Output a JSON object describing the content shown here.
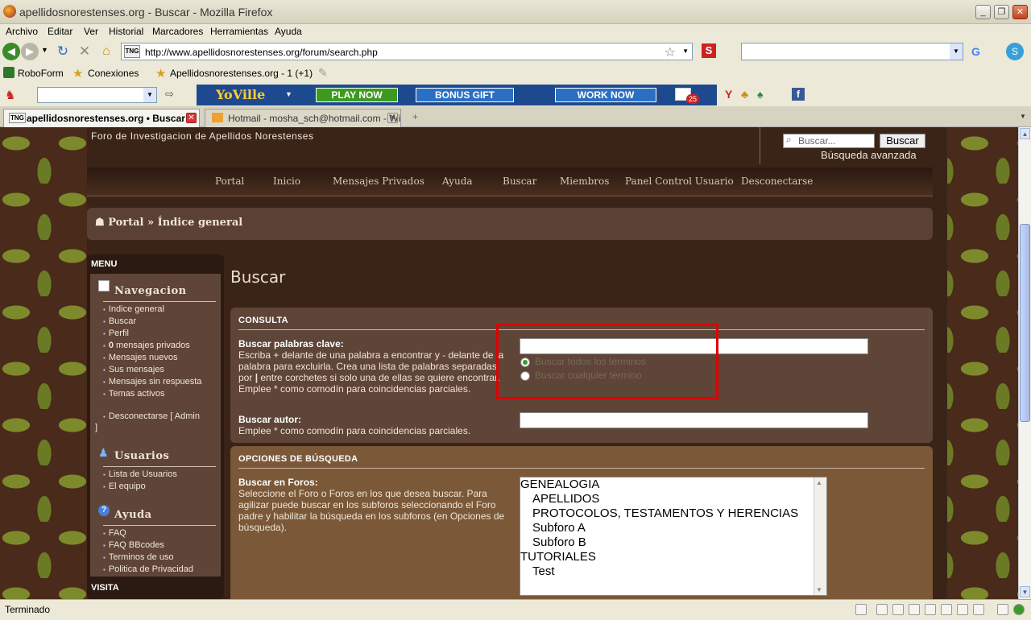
{
  "window": {
    "title": "apellidosnorestenses.org - Buscar - Mozilla Firefox"
  },
  "menubar": {
    "items": [
      "Archivo",
      "Editar",
      "Ver",
      "Historial",
      "Marcadores",
      "Herramientas",
      "Ayuda"
    ]
  },
  "navbar": {
    "url": "http://www.apellidosnorestenses.org/forum/search.php"
  },
  "bookmarks": {
    "items": [
      "RoboForm",
      "Conexiones",
      "Apellidosnorestenses.org - 1 (+1)"
    ]
  },
  "gamebar": {
    "brand": "YoVille",
    "play_now": "PLAY NOW",
    "bonus_gift": "BONUS GIFT",
    "work_now": "WORK NOW",
    "mail_count": "25"
  },
  "tabs": [
    {
      "label": "apellidosnorestenses.org • Buscar"
    },
    {
      "label": "Hotmail - mosha_sch@hotmail.com - Wi..."
    }
  ],
  "site": {
    "subtitle": "Foro de Investigacion de Apellidos Norestenses",
    "search_placeholder": "Buscar...",
    "search_button": "Buscar",
    "advanced_search": "Búsqueda avanzada",
    "nav": [
      "Portal",
      "Inicio",
      "Mensajes Privados",
      "Ayuda",
      "Buscar",
      "Miembros",
      "Panel Control Usuario",
      "Desconectarse"
    ],
    "breadcrumb": "Portal » Índice general"
  },
  "sidebar": {
    "menu_label": "MENU",
    "nav_title": "Navegacion",
    "nav_items": [
      "Indice general",
      "Buscar",
      "Perfil",
      "mensajes privados",
      "Mensajes nuevos",
      "Sus mensajes",
      "Mensajes sin respuesta",
      "Temas activos"
    ],
    "private_count": "0",
    "logout": "Desconectarse [ Admin",
    "logout_close": "]",
    "users_title": "Usuarios",
    "users_items": [
      "Lista de Usuarios",
      "El equipo"
    ],
    "help_title": "Ayuda",
    "help_items": [
      "FAQ",
      "FAQ BBcodes",
      "Terminos de uso",
      "Politica de Privacidad"
    ],
    "visit_label": "VISITA"
  },
  "main": {
    "title": "Buscar",
    "consulta": {
      "heading": "CONSULTA",
      "keywords_label": "Buscar palabras clave:",
      "keywords_desc_1": "Escriba + delante de una palabra a encontrar y - delante de la palabra para excluirla. Crea una lista de palabras separadas por ",
      "keywords_desc_pipe": "|",
      "keywords_desc_2": " entre corchetes si solo una de ellas se quiere encontrar. Emplee * como comodín para coincidencias parciales.",
      "keywords_value": "",
      "radio_all": "Buscar todos los términos",
      "radio_any": "Buscar cualquier término",
      "author_label": "Buscar autor:",
      "author_desc": "Emplee * como comodín para coincidencias parciales.",
      "author_value": ""
    },
    "opciones": {
      "heading": "OPCIONES DE BÚSQUEDA",
      "forums_label": "Buscar en Foros:",
      "forums_desc": "Seleccione el Foro o Foros en los que desea buscar. Para agilizar puede buscar en los subforos seleccionando el Foro padre y habilitar la búsqueda en los subforos (en Opciones de búsqueda).",
      "forums": [
        {
          "label": "GENEALOGIA",
          "sub": false
        },
        {
          "label": "APELLIDOS",
          "sub": true
        },
        {
          "label": "PROTOCOLOS, TESTAMENTOS Y HERENCIAS",
          "sub": true
        },
        {
          "label": "Subforo A",
          "sub": true
        },
        {
          "label": "Subforo B",
          "sub": true
        },
        {
          "label": "TUTORIALES",
          "sub": false
        },
        {
          "label": "Test",
          "sub": true
        }
      ]
    }
  },
  "status": {
    "text": "Terminado"
  },
  "colors": {
    "highlight": "#e00000",
    "page_bg": "#3a2418",
    "panel": "#5e4538"
  }
}
